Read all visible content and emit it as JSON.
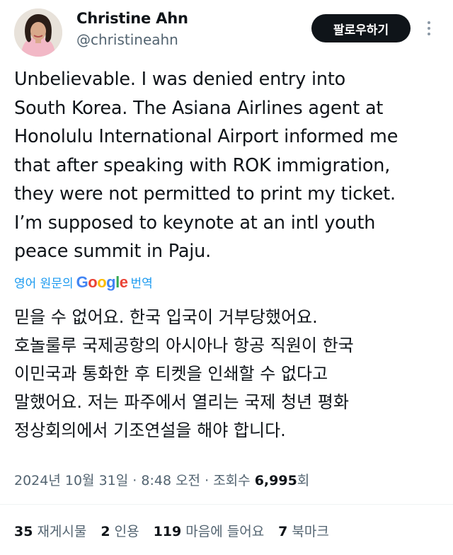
{
  "author": {
    "name": "Christine Ahn",
    "handle": "@christineahn",
    "follow_label": "팔로우하기"
  },
  "tweet": {
    "lines": [
      "Unbelievable. I was denied entry into",
      "South Korea. The Asiana Airlines agent at",
      "Honolulu International Airport informed me",
      "that after speaking with ROK immigration,",
      "they were not permitted to print my ticket.",
      "I’m supposed to keynote at an intl youth",
      "peace summit in Paju."
    ]
  },
  "translation": {
    "prefix": "영어 원문의",
    "suffix": "번역",
    "provider": "Google",
    "lines": [
      "믿을 수 없어요. 한국 입국이 거부당했어요.",
      "호놀룰루 국제공항의 아시아나 항공 직원이 한국",
      "이민국과 통화한 후 티켓을 인쇄할 수 없다고",
      "말했어요. 저는 파주에서 열리는 국제 청년 평화",
      "정상회의에서 기조연설을 해야 합니다."
    ]
  },
  "meta": {
    "date": "2024년 10월 31일",
    "sep": "·",
    "time": "8:48 오전",
    "views_label": "조회수",
    "views": "6,995",
    "views_unit": "회"
  },
  "stats": {
    "reposts_count": "35",
    "reposts_label": "재게시물",
    "quotes_count": "2",
    "quotes_label": "인용",
    "likes_count": "119",
    "likes_label": "마음에 들어요",
    "bookmarks_count": "7",
    "bookmarks_label": "북마크"
  },
  "icons": {
    "more": "more-vertical-icon"
  }
}
